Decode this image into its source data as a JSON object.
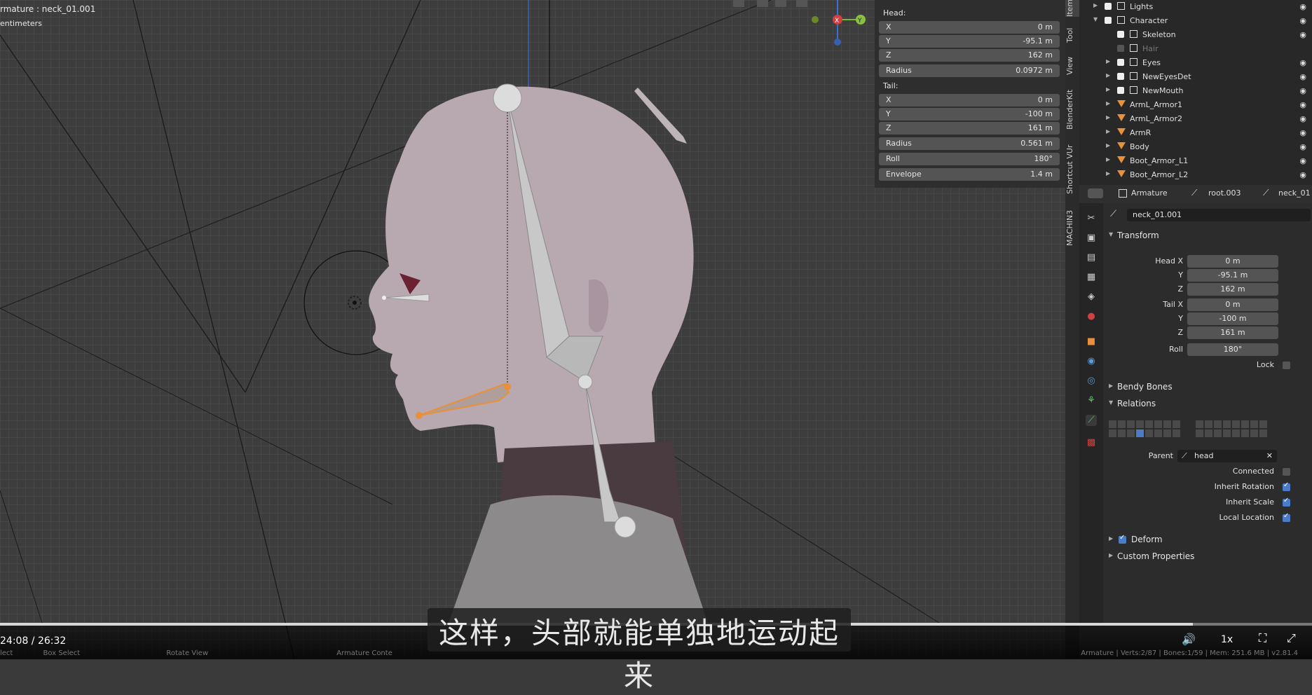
{
  "viewport": {
    "object_label": "rmature : neck_01.001",
    "units_label": "entimeters",
    "gizmo_x": "X",
    "gizmo_y": "Y"
  },
  "bone_panel": {
    "head_title": "Head:",
    "head": [
      {
        "label": "X",
        "value": "0 m"
      },
      {
        "label": "Y",
        "value": "-95.1 m"
      },
      {
        "label": "Z",
        "value": "162 m"
      },
      {
        "label": "Radius",
        "value": "0.0972 m"
      }
    ],
    "tail_title": "Tail:",
    "tail": [
      {
        "label": "X",
        "value": "0 m"
      },
      {
        "label": "Y",
        "value": "-100 m"
      },
      {
        "label": "Z",
        "value": "161 m"
      },
      {
        "label": "Radius",
        "value": "0.561 m"
      },
      {
        "label": "Roll",
        "value": "180°"
      },
      {
        "label": "Envelope",
        "value": "1.4 m"
      }
    ]
  },
  "side_tabs": [
    "Item",
    "Tool",
    "View",
    "BlenderKit",
    "Shortcut VUr",
    "MACHIN3"
  ],
  "outliner": [
    {
      "name": "Lights",
      "level": 1,
      "checked": true,
      "collection": true
    },
    {
      "name": "Character",
      "level": 1,
      "checked": true,
      "collection": true
    },
    {
      "name": "Skeleton",
      "level": 2,
      "checked": true,
      "collection": true
    },
    {
      "name": "Hair",
      "level": 2,
      "checked": false,
      "collection": true
    },
    {
      "name": "Eyes",
      "level": 2,
      "checked": true,
      "collection": true
    },
    {
      "name": "NewEyesDet",
      "level": 2,
      "checked": true,
      "collection": true
    },
    {
      "name": "NewMouth",
      "level": 2,
      "checked": true,
      "collection": true
    },
    {
      "name": "ArmL_Armor1",
      "level": 2,
      "checked": null,
      "collection": false
    },
    {
      "name": "ArmL_Armor2",
      "level": 2,
      "checked": null,
      "collection": false
    },
    {
      "name": "ArmR",
      "level": 2,
      "checked": null,
      "collection": false
    },
    {
      "name": "Body",
      "level": 2,
      "checked": null,
      "collection": false
    },
    {
      "name": "Boot_Armor_L1",
      "level": 2,
      "checked": null,
      "collection": false
    },
    {
      "name": "Boot_Armor_L2",
      "level": 2,
      "checked": null,
      "collection": false
    }
  ],
  "props_header": {
    "armature": "Armature",
    "root": "root.003",
    "bone": "neck_01"
  },
  "props": {
    "bone_name": "neck_01.001",
    "transform_title": "Transform",
    "transform": [
      {
        "label": "Head X",
        "value": "0 m"
      },
      {
        "label": "Y",
        "value": "-95.1 m"
      },
      {
        "label": "Z",
        "value": "162 m"
      },
      {
        "label": "Tail X",
        "value": "0 m"
      },
      {
        "label": "Y",
        "value": "-100 m"
      },
      {
        "label": "Z",
        "value": "161 m"
      },
      {
        "label": "Roll",
        "value": "180°"
      }
    ],
    "lock_label": "Lock",
    "bendy_title": "Bendy Bones",
    "relations_title": "Relations",
    "parent_label": "Parent",
    "parent_value": "head",
    "connected_label": "Connected",
    "inherit_rotation_label": "Inherit Rotation",
    "inherit_scale_label": "Inherit Scale",
    "local_location_label": "Local Location",
    "deform_title": "Deform",
    "custom_title": "Custom Properties",
    "connected": false,
    "inherit_rotation": true,
    "inherit_scale": true,
    "local_location": true,
    "deform": true
  },
  "player": {
    "time": "24:08 / 26:32",
    "speed": "1x",
    "subtitle": "这样，头部就能单独地运动起来",
    "status_left": [
      "lect",
      "Box Select",
      "Rotate View",
      "Armature Conte"
    ],
    "status_right": "Armature | Verts:2/87 | Bones:1/59 | Mem: 251.6 MB | v2.81.4",
    "progress": 0.909
  },
  "colors": {
    "selected_bone": "#e8903a",
    "bone": "#c8c8c8",
    "skin": "#b8a8b0",
    "accent": "#4a7cc9"
  }
}
